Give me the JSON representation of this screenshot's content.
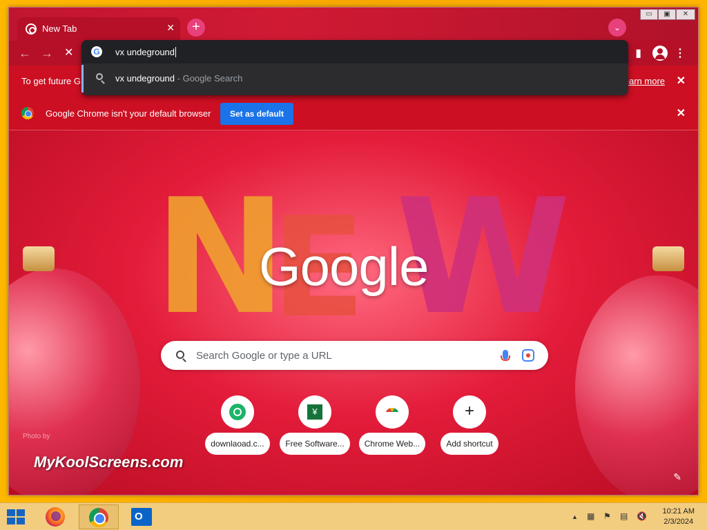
{
  "window": {
    "tab_title": "New Tab",
    "tab_close": "✕",
    "new_tab": "+",
    "tab_search": "⌄",
    "controls": [
      "▭",
      "▣",
      "✕"
    ]
  },
  "toolbar": {
    "back": "←",
    "forward": "→",
    "stop": "✕",
    "side_panel": "▮",
    "menu": "⋮"
  },
  "omnibox": {
    "input_value": "vx undeground",
    "suggestion_query": "vx undeground",
    "suggestion_suffix": "- Google Search",
    "engine_icon": "G"
  },
  "info_bar_sync": {
    "text": "To get future G",
    "link": "earn more"
  },
  "info_bar_default": {
    "text": "Google Chrome isn't your default browser",
    "button": "Set as default"
  },
  "ntp": {
    "logo": "Google",
    "search_placeholder": "Search Google or type a URL",
    "shortcuts": [
      {
        "label": "downlaoad.c...",
        "icon": "download-site-icon"
      },
      {
        "label": "Free Software...",
        "icon": "free-software-icon"
      },
      {
        "label": "Chrome Web...",
        "icon": "chrome-web-store-icon"
      },
      {
        "label": "Add shortcut",
        "icon": "plus-icon"
      }
    ],
    "photo_credit": "Photo by",
    "watermark": "MyKoolScreens.com"
  },
  "taskbar": {
    "time": "10:21 AM",
    "date": "2/3/2024",
    "outlook_letter": "O",
    "free_software_glyph": "¥",
    "add_glyph": "+",
    "edit_glyph": "✎",
    "tray_icons": [
      "▲",
      "▦",
      "⚑",
      "▤",
      "🔇"
    ]
  },
  "colors": {
    "tab_active": "#b51028",
    "accent_blue": "#1a73e8",
    "infobar": "#cc0f22",
    "taskbar": "#f2cd80"
  }
}
